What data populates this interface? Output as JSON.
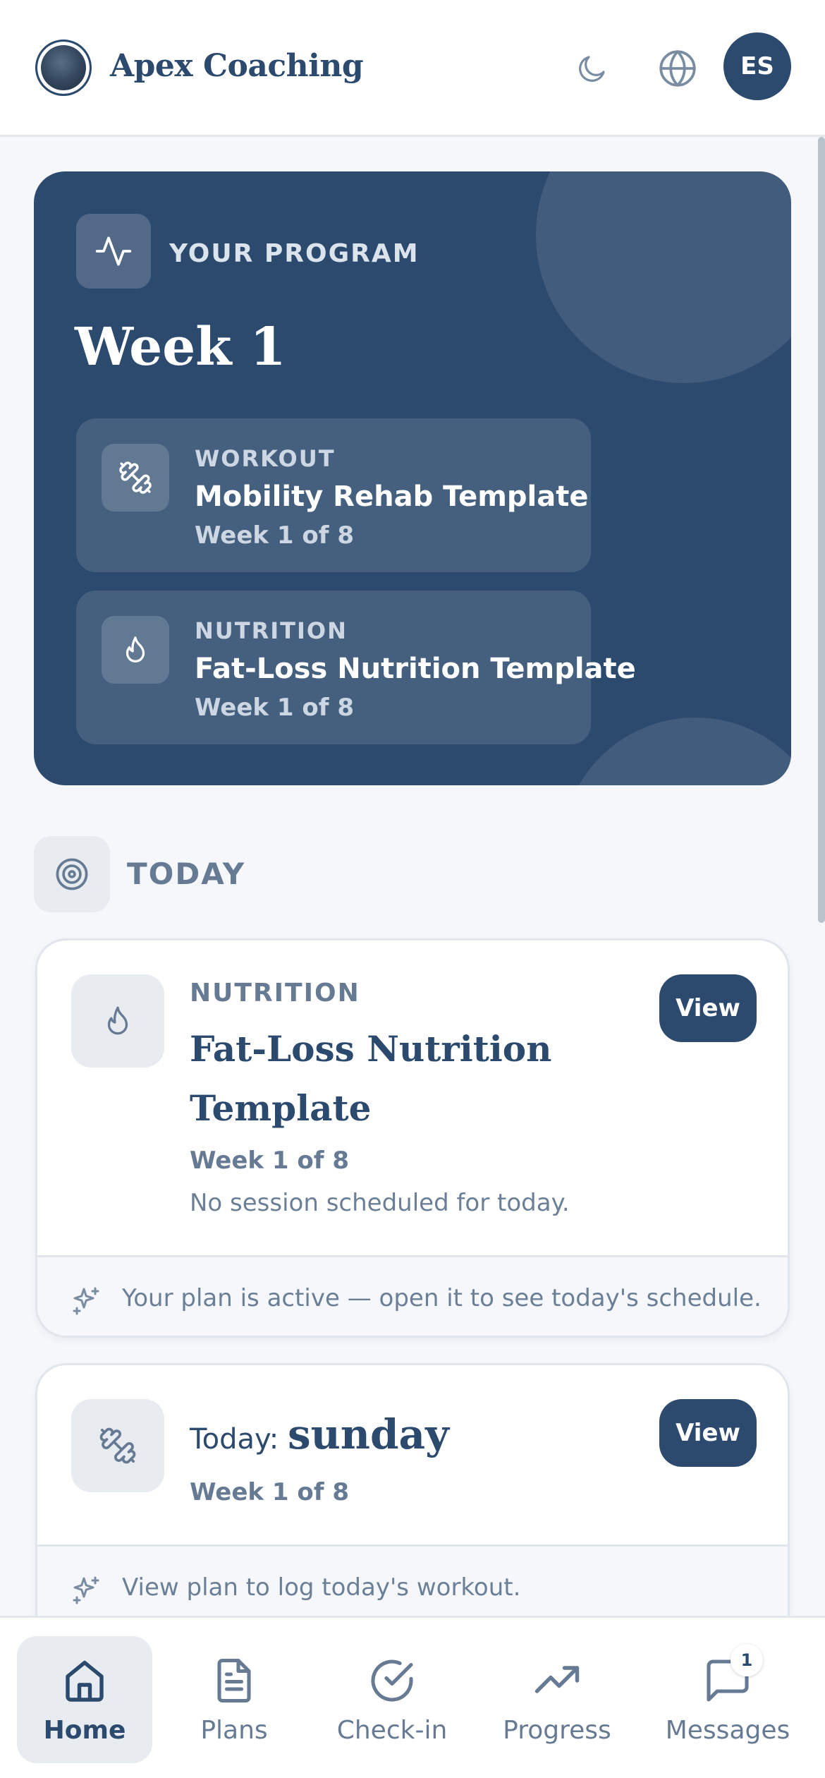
{
  "header": {
    "brand": "Apex Coaching",
    "avatar_initials": "ES",
    "icons": [
      "moon-icon",
      "globe-icon"
    ]
  },
  "program": {
    "label": "YOUR PROGRAM",
    "week_title": "Week 1",
    "plans": [
      {
        "type": "WORKOUT",
        "name": "Mobility Rehab Template",
        "week": "Week 1 of 8",
        "icon": "dumbbell-icon"
      },
      {
        "type": "NUTRITION",
        "name": "Fat-Loss Nutrition Template",
        "week": "Week 1 of 8",
        "icon": "flame-icon"
      }
    ]
  },
  "today": {
    "label": "TODAY",
    "nutrition_card": {
      "type": "NUTRITION",
      "title": "Fat-Loss Nutrition Template",
      "week": "Week 1 of 8",
      "message": "No session scheduled for today.",
      "button": "View",
      "footer": "Your plan is active — open it to see today's schedule."
    },
    "workout_card": {
      "today_prefix": "Today:",
      "day": "sunday",
      "week": "Week 1 of 8",
      "button": "View",
      "footer": "View plan to log today's workout."
    }
  },
  "nav": {
    "items": [
      {
        "label": "Home",
        "icon": "home-icon",
        "active": true
      },
      {
        "label": "Plans",
        "icon": "document-icon",
        "active": false
      },
      {
        "label": "Check-in",
        "icon": "check-circle-icon",
        "active": false
      },
      {
        "label": "Progress",
        "icon": "trending-up-icon",
        "active": false
      },
      {
        "label": "Messages",
        "icon": "message-icon",
        "active": false,
        "badge": "1"
      }
    ]
  },
  "colors": {
    "primary": "#2c4a6e",
    "muted": "#667b93",
    "background": "#f5f7fa"
  }
}
